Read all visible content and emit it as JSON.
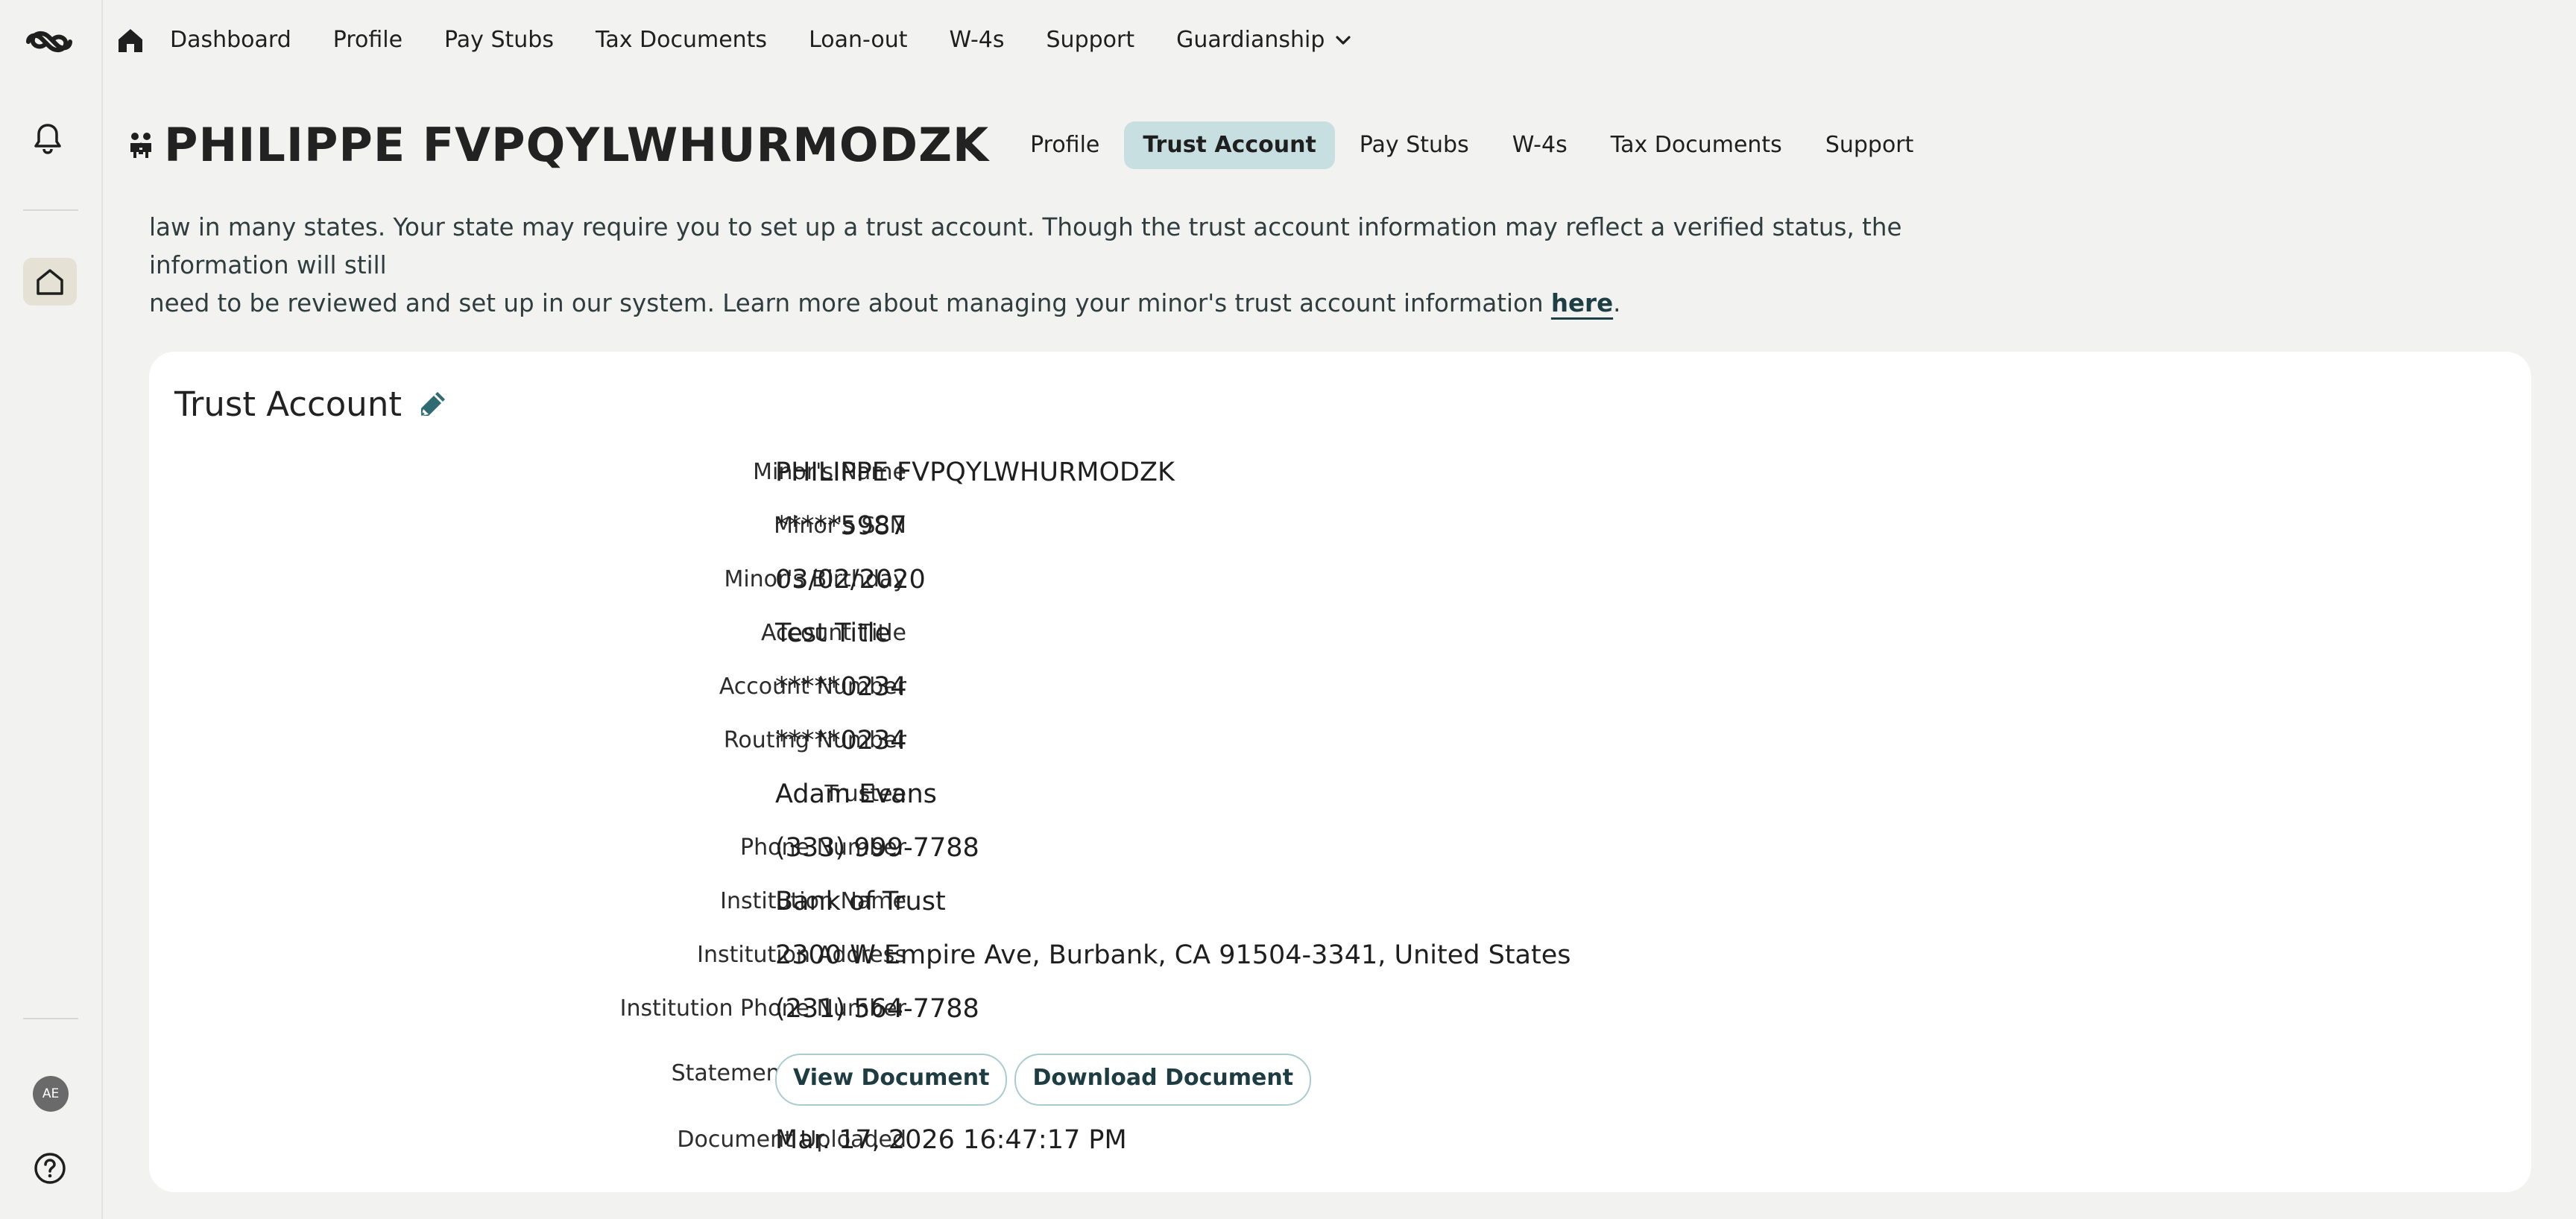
{
  "topnav": {
    "links": [
      "Dashboard",
      "Profile",
      "Pay Stubs",
      "Tax Documents",
      "Loan-out",
      "W-4s",
      "Support"
    ],
    "guardianship": "Guardianship"
  },
  "rail": {
    "avatar_initials": "AE"
  },
  "subheader": {
    "name": "PHILIPPE FVPQYLWHURMODZK",
    "tabs": [
      "Profile",
      "Trust Account",
      "Pay Stubs",
      "W-4s",
      "Tax Documents",
      "Support"
    ],
    "active_tab": "Trust Account"
  },
  "notice": {
    "line1": "law in many states. Your state may require you to set up a trust account. Though the trust account information may reflect a verified status, the information will still",
    "line2_prefix": "need to be reviewed and set up in our system. Learn more about managing your minor's trust account information ",
    "link": "here",
    "line2_suffix": "."
  },
  "card": {
    "title": "Trust Account",
    "fields": [
      {
        "label": "Minor's Name",
        "value": "PHILIPPE FVPQYLWHURMODZK"
      },
      {
        "label": "Minor's SSN",
        "value": "*****5987"
      },
      {
        "label": "Minor's Birthday",
        "value": "03/02/2020"
      },
      {
        "label": "Account Title",
        "value": "Test Title"
      },
      {
        "label": "Account Number",
        "value": "*****0234"
      },
      {
        "label": "Routing Number",
        "value": "*****0234"
      },
      {
        "label": "Trustee",
        "value": "Adam Evans"
      },
      {
        "label": "Phone Number",
        "value": "(333) 999-7788"
      },
      {
        "label": "Institution Name",
        "value": "Bank of Trust"
      },
      {
        "label": "Institution Address",
        "value": "2300 W Empire Ave, Burbank, CA 91504-3341, United States"
      },
      {
        "label": "Institution Phone Number",
        "value": "(231) 564-7788"
      }
    ],
    "statement": {
      "label": "Statement of Trustee",
      "view_button": "View Document",
      "download_button": "Download Document"
    },
    "uploaded": {
      "label": "Document Uploaded",
      "value": "Mar. 17, 2026 16:47:17 PM"
    }
  },
  "colors": {
    "background": "#f2f2f0",
    "active_tab": "#c8dfe2",
    "button_border": "#a9ccd1",
    "link": "#1d3e44",
    "card": "#ffffff"
  }
}
